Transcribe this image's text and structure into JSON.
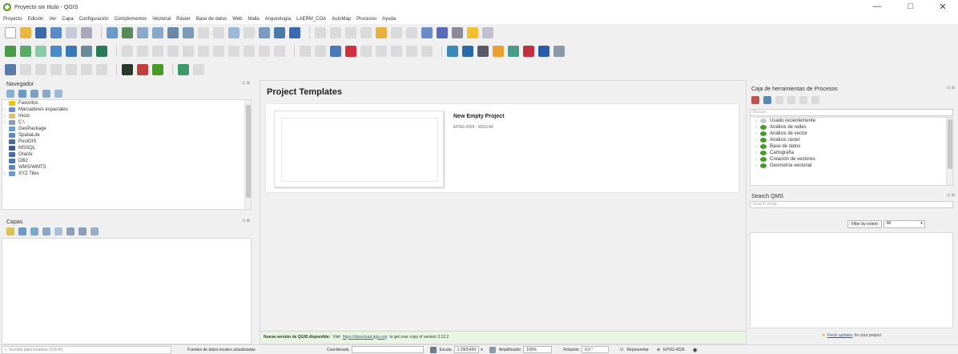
{
  "window": {
    "title": "Proyecto sin título - QGIS",
    "minimize": "—",
    "maximize": "□",
    "close": "✕"
  },
  "menu": [
    "Proyecto",
    "Edición",
    "Ver",
    "Capa",
    "Configuración",
    "Complementos",
    "Vectorial",
    "Ráster",
    "Base de datos",
    "Web",
    "Malla",
    "Arqueología",
    "LAERM_COA",
    "AutoMap",
    "Procesos",
    "Ayuda"
  ],
  "colors": {
    "accent_green": "#4a9a2a",
    "link_blue": "#2a5db0",
    "news_bg": "#e8f5e0"
  },
  "navegador": {
    "title": "Navegador",
    "dock_controls": "⊡ ⊠",
    "items": [
      {
        "label": "Favoritos",
        "expander": "",
        "icon": "star-icon",
        "color": "#f0c000"
      },
      {
        "label": "Marcadores espaciales",
        "expander": "›",
        "icon": "bookmark-icon",
        "color": "#6a8fc8"
      },
      {
        "label": "Inicio",
        "expander": "›",
        "icon": "folder-icon",
        "color": "#e0c070"
      },
      {
        "label": "C:\\",
        "expander": "›",
        "icon": "drive-icon",
        "color": "#8aa0b8"
      },
      {
        "label": "GeoPackage",
        "expander": "",
        "icon": "geopackage-icon",
        "color": "#6aa0d0"
      },
      {
        "label": "SpatiaLite",
        "expander": "",
        "icon": "spatialite-icon",
        "color": "#5a8ac0"
      },
      {
        "label": "PostGIS",
        "expander": "",
        "icon": "postgis-icon",
        "color": "#4a6a9a"
      },
      {
        "label": "MSSQL",
        "expander": "",
        "icon": "mssql-icon",
        "color": "#3a5a8a"
      },
      {
        "label": "Oracle",
        "expander": "",
        "icon": "oracle-icon",
        "color": "#4a6aaa"
      },
      {
        "label": "DB2",
        "expander": "",
        "icon": "db2-icon",
        "color": "#4a7ab0"
      },
      {
        "label": "WMS/WMTS",
        "expander": "",
        "icon": "wms-icon",
        "color": "#5a8ac0"
      },
      {
        "label": "XYZ Tiles",
        "expander": "›",
        "icon": "xyz-tiles-icon",
        "color": "#6a9ac8"
      }
    ]
  },
  "capas": {
    "title": "Capas",
    "dock_controls": "⊡ ⊠"
  },
  "center": {
    "heading": "Project Templates",
    "template": {
      "name": "New Empty Project",
      "crs": "EPSG:4326 - WGS 84"
    },
    "news": {
      "bold": "Nueva versión de QGIS disponible:",
      "pre": "Visit",
      "link": "https://download.qgis.org",
      "post": "to get your copy of version 3.12.2"
    }
  },
  "procesos": {
    "title": "Caja de herramientas de Procesos",
    "search_placeholder": "Buscar...",
    "items": [
      {
        "label": "Usado recientemente",
        "icon": "clock-icon"
      },
      {
        "label": "Análisis de redes",
        "icon": "qgis-icon"
      },
      {
        "label": "Análisis de vector",
        "icon": "qgis-icon"
      },
      {
        "label": "Análisis ráster",
        "icon": "qgis-icon"
      },
      {
        "label": "Base de datos",
        "icon": "qgis-icon"
      },
      {
        "label": "Cartografía",
        "icon": "qgis-icon"
      },
      {
        "label": "Creación de vectores",
        "icon": "qgis-icon"
      },
      {
        "label": "Geometría vectorial",
        "icon": "qgis-icon"
      }
    ]
  },
  "quickmap": {
    "title": "Search QMS",
    "search_placeholder": "Search string...",
    "filter_button": "Filter by extent",
    "filter_value": "All",
    "update_link": "Fresh updates",
    "update_text": "for your project"
  },
  "status": {
    "locator_placeholder": "Escribe para localizar (Ctrl+K)",
    "message": "Fuentes de datos locales actualizadas",
    "coord_label": "Coordenada",
    "coord_value": "",
    "scale_label": "Escala",
    "scale_value": "1:2905459",
    "magnifier_label": "Amplificador",
    "magnifier_value": "100%",
    "rotation_label": "Rotación",
    "rotation_value": "0,0 °",
    "render_label": "Representar",
    "crs": "EPSG:4326"
  }
}
